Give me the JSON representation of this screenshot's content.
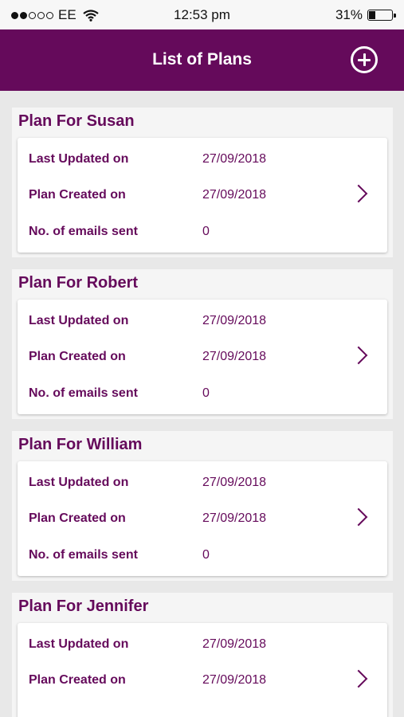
{
  "status_bar": {
    "carrier": "EE",
    "time": "12:53 pm",
    "battery": "31%",
    "signal_icon": "signal-dots-icon",
    "wifi_icon": "wifi-icon",
    "battery_icon": "battery-icon"
  },
  "header": {
    "title": "List of Plans",
    "add_icon": "add-circle-icon"
  },
  "colors": {
    "brand": "#650a5b",
    "background": "#e8e8e8"
  },
  "labels": {
    "last_updated": "Last Updated on",
    "created": "Plan Created on",
    "emails": "No. of emails sent"
  },
  "plans": [
    {
      "name": "Plan For Susan",
      "last_updated": "27/09/2018",
      "created": "27/09/2018",
      "emails_sent": "0"
    },
    {
      "name": "Plan For Robert",
      "last_updated": "27/09/2018",
      "created": "27/09/2018",
      "emails_sent": "0"
    },
    {
      "name": "Plan For William",
      "last_updated": "27/09/2018",
      "created": "27/09/2018",
      "emails_sent": "0"
    },
    {
      "name": "Plan For Jennifer",
      "last_updated": "27/09/2018",
      "created": "27/09/2018",
      "emails_sent": ""
    }
  ]
}
